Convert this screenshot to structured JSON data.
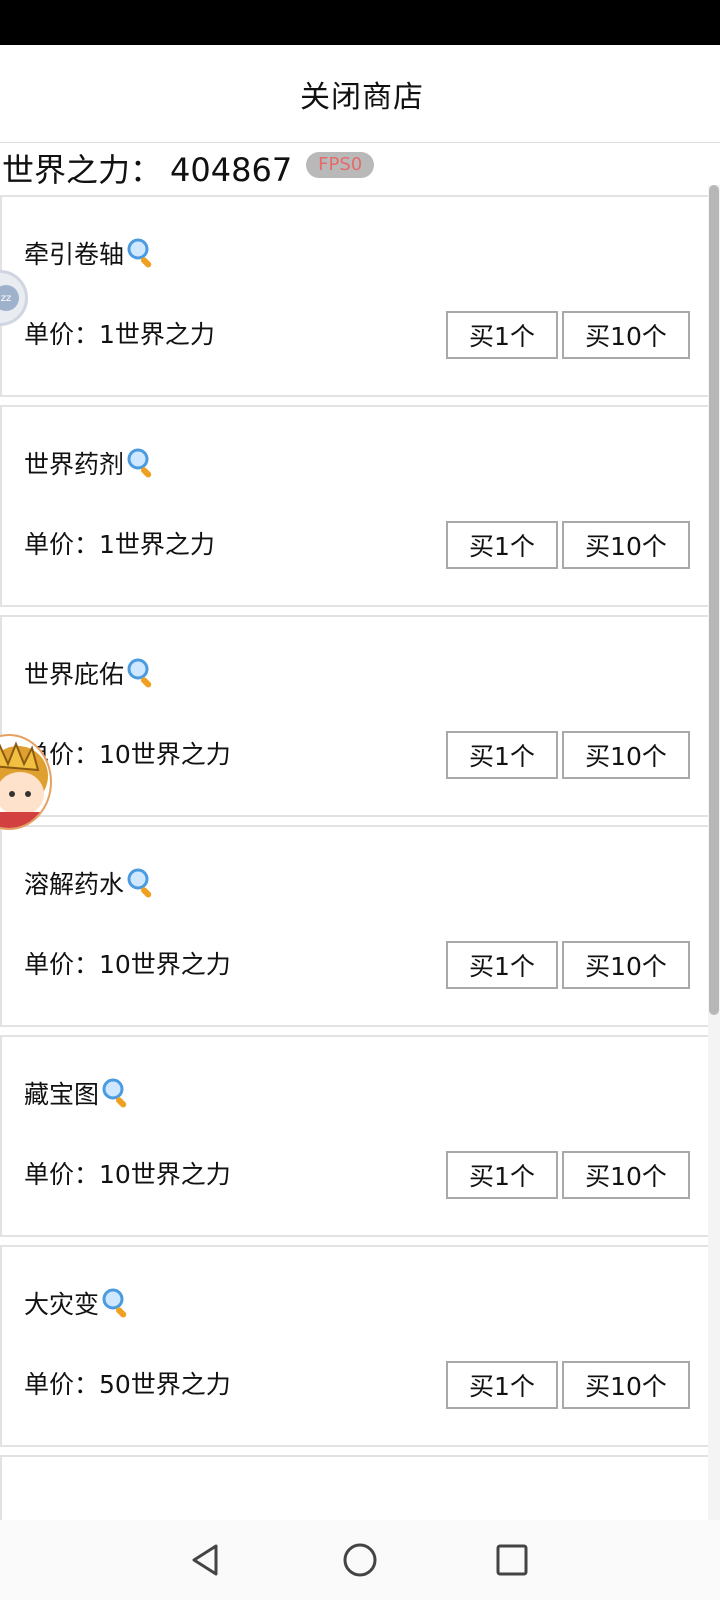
{
  "header": {
    "title": "关闭商店"
  },
  "currency": {
    "label": "世界之力：",
    "value": "404867",
    "fps_badge": "FPS0"
  },
  "items": [
    {
      "name": "牵引卷轴",
      "price": "单价：1世界之力",
      "buy_one": "买1个",
      "buy_ten": "买10个"
    },
    {
      "name": "世界药剂",
      "price": "单价：1世界之力",
      "buy_one": "买1个",
      "buy_ten": "买10个"
    },
    {
      "name": "世界庇佑",
      "price": "单价：10世界之力",
      "buy_one": "买1个",
      "buy_ten": "买10个"
    },
    {
      "name": "溶解药水",
      "price": "单价：10世界之力",
      "buy_one": "买1个",
      "buy_ten": "买10个"
    },
    {
      "name": "藏宝图",
      "price": "单价：10世界之力",
      "buy_one": "买1个",
      "buy_ten": "买10个"
    },
    {
      "name": "大灾变",
      "price": "单价：50世界之力",
      "buy_one": "买1个",
      "buy_ten": "买10个"
    }
  ],
  "float_ball": {
    "label": "zz"
  },
  "icons": {
    "item_info": "magnifier-icon",
    "nav_back": "back-triangle-icon",
    "nav_home": "home-circle-icon",
    "nav_recent": "recent-square-icon"
  },
  "colors": {
    "fps_text": "#e56b6b",
    "card_border": "#e2e2e2",
    "button_border": "#a9a9a9"
  }
}
